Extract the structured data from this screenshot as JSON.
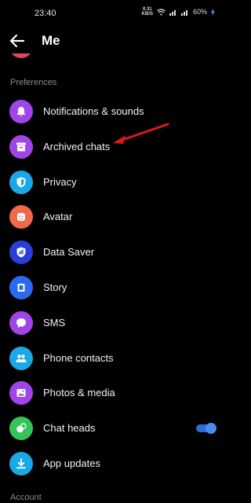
{
  "status_bar": {
    "time": "23:40",
    "net_speed": "0.31",
    "net_unit": "KB/S",
    "battery": "60%"
  },
  "header": {
    "title": "Me"
  },
  "sections": {
    "preferences": "Preferences",
    "account": "Account"
  },
  "items": [
    {
      "label": "Notifications & sounds",
      "color": "#a045e8",
      "icon": "bell-icon"
    },
    {
      "label": "Archived chats",
      "color": "#a045e8",
      "icon": "archive-icon"
    },
    {
      "label": "Privacy",
      "color": "#1aa8e6",
      "icon": "shield-icon"
    },
    {
      "label": "Avatar",
      "color": "#ef6a4a",
      "icon": "avatar-icon"
    },
    {
      "label": "Data Saver",
      "color": "#2a3fd8",
      "icon": "data-saver-icon"
    },
    {
      "label": "Story",
      "color": "#2a6af0",
      "icon": "story-icon"
    },
    {
      "label": "SMS",
      "color": "#a045e8",
      "icon": "sms-icon"
    },
    {
      "label": "Phone contacts",
      "color": "#1aa8e6",
      "icon": "contacts-icon"
    },
    {
      "label": "Photos & media",
      "color": "#a045e8",
      "icon": "photo-icon"
    },
    {
      "label": "Chat heads",
      "color": "#35c457",
      "icon": "chat-heads-icon",
      "toggle": true
    },
    {
      "label": "App updates",
      "color": "#1aa8e6",
      "icon": "download-icon"
    }
  ],
  "annotation_color": "#e01818"
}
